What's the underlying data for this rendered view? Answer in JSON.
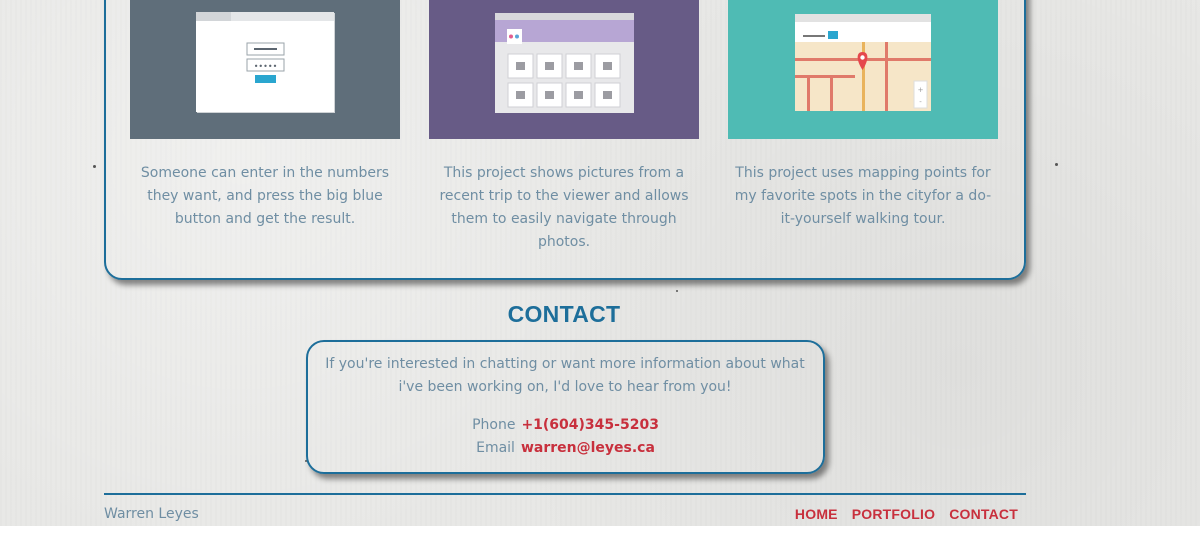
{
  "projects": [
    {
      "icon": "login-form-icon",
      "description": "Someone can enter in the numbers they want, and press the big blue button and get the result.",
      "bg_color": "#5f6e7a"
    },
    {
      "icon": "photo-gallery-icon",
      "description": "This project shows pictures from a recent trip to the viewer and allows them to easily navigate through photos.",
      "bg_color": "#675b86"
    },
    {
      "icon": "map-icon",
      "description": "This project uses mapping points for my favorite spots in the cityfor a do-it-yourself walking tour.",
      "bg_color": "#4fbbb4"
    }
  ],
  "contact": {
    "heading": "CONTACT",
    "intro": "If you're interested in chatting or want more information about what i've been working on, I'd love to hear from you!",
    "phone_label": "Phone",
    "phone_value": "+1(604)345-5203",
    "email_label": "Email",
    "email_value": "warren@leyes.ca"
  },
  "footer": {
    "name": "Warren Leyes",
    "nav": [
      "HOME",
      "PORTFOLIO",
      "CONTACT"
    ]
  },
  "colors": {
    "accent_blue": "#1d6e9a",
    "link_red": "#c8303d",
    "body_text": "#6f8ea3"
  }
}
